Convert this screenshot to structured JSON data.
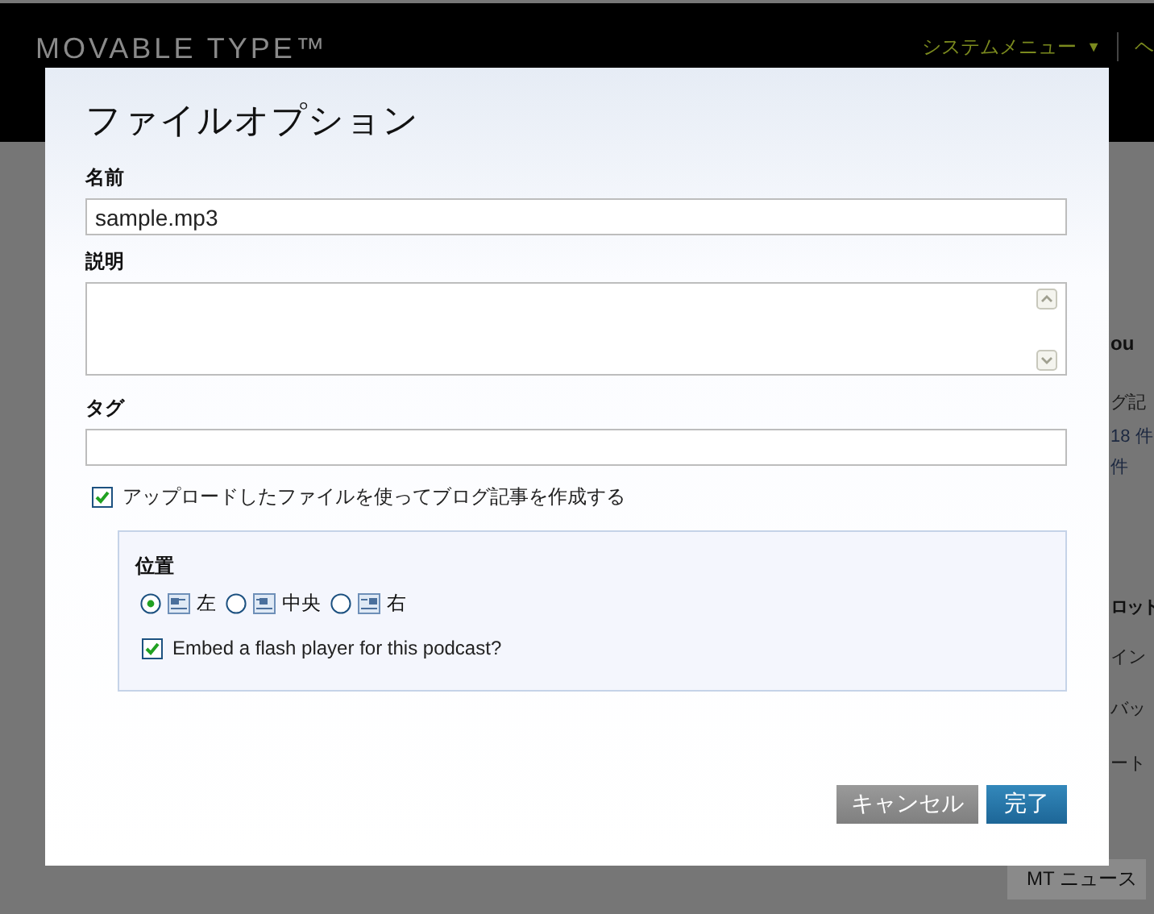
{
  "background_page": {
    "logo": "MOVABLE TYPE™",
    "system_menu": "システムメニュー",
    "menu_caret": "▼",
    "help_fragment": "ヘ",
    "sidebar_fragments": [
      {
        "kind": "heading",
        "text": "ou"
      },
      {
        "kind": "text",
        "text": "グ記"
      },
      {
        "kind": "text",
        "text": "18 件"
      },
      {
        "kind": "text",
        "text": "件"
      },
      {
        "kind": "heading",
        "text": "ロット"
      },
      {
        "kind": "text",
        "text": "イン"
      },
      {
        "kind": "text",
        "text": "バッ"
      },
      {
        "kind": "text",
        "text": "ート"
      }
    ],
    "news_tab": "MT ニュース"
  },
  "dialog": {
    "title": "ファイルオプション",
    "fields": [
      {
        "kind": "text",
        "label": "名前",
        "value": "sample.mp3"
      },
      {
        "kind": "textarea",
        "label": "説明"
      },
      {
        "kind": "text",
        "label": "タグ"
      }
    ],
    "create_entry": {
      "label": "アップロードしたファイルを使ってブログ記事を作成する",
      "checked": true
    },
    "position": {
      "label": "位置",
      "options": [
        {
          "kind": "left",
          "label": "左",
          "selected": true
        },
        {
          "kind": "center",
          "label": "中央",
          "selected": false
        },
        {
          "kind": "right",
          "label": "右",
          "selected": false
        }
      ],
      "embed_player": {
        "label": "Embed a flash player for this podcast?",
        "checked": true
      }
    },
    "buttons": [
      {
        "kind": "secondary",
        "label": "キャンセル"
      },
      {
        "kind": "primary",
        "label": "完了"
      }
    ]
  }
}
